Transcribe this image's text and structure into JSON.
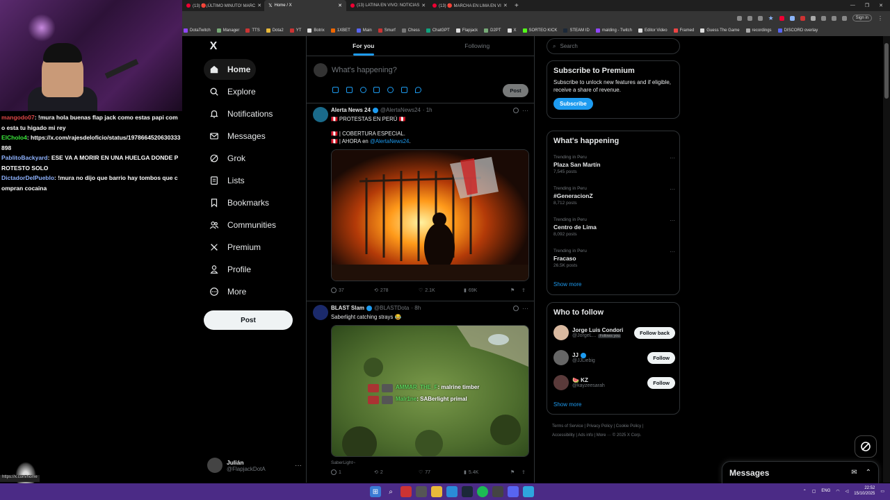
{
  "browser": {
    "tabs": [
      {
        "label": "(13) 🔴¡ÚLTIMO MINUTO! MARC"
      },
      {
        "label": "Home / X"
      },
      {
        "label": "(13) LATINA EN VIVO: NOTICIAS"
      },
      {
        "label": "(13) 🔴 MARCHA EN LIMA EN VI"
      }
    ],
    "new_tab": "+",
    "signin": "Sign in",
    "bookmarks": [
      "DotaTwitch",
      "Manager",
      "TTS",
      "Dota2",
      "YT",
      "Botrix",
      "1XBET",
      "Main",
      "Smurf",
      "Chess",
      "ChatGPT",
      "Flapjack",
      "D2PT",
      "X",
      "SORTEO KICK",
      "STEAM ID",
      "malding - Twitch",
      "Editor Video",
      "Framed",
      "Guess The Game",
      "recordings",
      "DISCORD overlay"
    ]
  },
  "chat": {
    "messages": [
      {
        "user": "mangodo07",
        "color": "#e04848",
        "text": ": !mura hola buenas flap jack como estas papi como esta tu higado mi rey"
      },
      {
        "user": "ElCholo4",
        "color": "#3be83b",
        "text": ": https://x.com/rajesdeloficio/status/1978664520630333898"
      },
      {
        "user": "PablitoBackyard",
        "color": "#8fb3ff",
        "text": ": ESE VA A MORIR EN UNA HUELGA DONDE PROTESTO SOLO"
      },
      {
        "user": "DictadorDelPueblo",
        "color": "#8fb3ff",
        "text": ": !mura no dijo que barrio hay tombos que compran cocaina"
      }
    ],
    "status_url": "https://x.com/home"
  },
  "nav": {
    "logo": "X",
    "items": [
      {
        "label": "Home",
        "icon": "home-icon"
      },
      {
        "label": "Explore",
        "icon": "search-icon"
      },
      {
        "label": "Notifications",
        "icon": "bell-icon"
      },
      {
        "label": "Messages",
        "icon": "envelope-icon"
      },
      {
        "label": "Grok",
        "icon": "grok-icon"
      },
      {
        "label": "Lists",
        "icon": "list-icon"
      },
      {
        "label": "Bookmarks",
        "icon": "bookmark-icon"
      },
      {
        "label": "Communities",
        "icon": "people-icon"
      },
      {
        "label": "Premium",
        "icon": "x-icon"
      },
      {
        "label": "Profile",
        "icon": "person-icon"
      },
      {
        "label": "More",
        "icon": "more-circle-icon"
      }
    ],
    "post_label": "Post",
    "account": {
      "name": "Julián",
      "handle": "@FlapjackDotA"
    }
  },
  "feed": {
    "tabs": [
      "For you",
      "Following"
    ],
    "compose_placeholder": "What's happening?",
    "compose_post": "Post",
    "tweets": [
      {
        "name": "Alerta News 24",
        "handle": "@AlertaNews24",
        "time": "· 1h",
        "line1": "🇵🇪 PROTESTAS EN PERÚ 🇵🇪",
        "line2": "🇵🇪 | COBERTURA ESPECIAL.",
        "line3": "🇵🇪 | AHORA en ",
        "mention": "@AlertaNews24",
        "line3_end": ".",
        "replies": "37",
        "reposts": "278",
        "likes": "2.1K",
        "views": "69K"
      },
      {
        "name": "BLAST Slam",
        "handle": "@BLASTDota",
        "time": "· 8h",
        "line1": "Saberlight catching strays 😂",
        "overlay1_name": "AMMAR_THE_F",
        "overlay1_text": ": malrine timber",
        "overlay2_name": "Malr1ne",
        "overlay2_text": ": SABerlight primal",
        "caption": "SaberLight~",
        "replies": "1",
        "reposts": "2",
        "likes": "77",
        "views": "5.4K"
      }
    ]
  },
  "right": {
    "search_placeholder": "Search",
    "premium": {
      "title": "Subscribe to Premium",
      "text": "Subscribe to unlock new features and if eligible, receive a share of revenue.",
      "button": "Subscribe"
    },
    "happening": {
      "title": "What's happening",
      "trends": [
        {
          "context": "Trending in Peru",
          "topic": "Plaza San Martín",
          "posts": "7,545 posts"
        },
        {
          "context": "Trending in Peru",
          "topic": "#GeneracionZ",
          "posts": "8,712 posts"
        },
        {
          "context": "Trending in Peru",
          "topic": "Centro de Lima",
          "posts": "8,092 posts"
        },
        {
          "context": "Trending in Peru",
          "topic": "Fracaso",
          "posts": "26.5K posts"
        }
      ],
      "show_more": "Show more"
    },
    "who_to_follow": {
      "title": "Who to follow",
      "users": [
        {
          "name": "Jorge Luis Condori",
          "handle": "@JorgeL...",
          "follows_you": "Follows you",
          "button": "Follow back",
          "verified": false,
          "avatar_color": "#d9b9a0"
        },
        {
          "name": "JJ",
          "handle": "@JJLiebig",
          "follows_you": "",
          "button": "Follow",
          "verified": true,
          "avatar_color": "#666"
        },
        {
          "name": "🍉 KZ",
          "handle": "@kayzeesarah",
          "follows_you": "",
          "button": "Follow",
          "verified": false,
          "avatar_color": "#5a3a3a"
        }
      ],
      "show_more": "Show more"
    },
    "footer": {
      "line1": "Terms of Service  |  Privacy Policy  |  Cookie Policy  |",
      "line2": "Accessibility  |  Ads info  |  More ···  © 2025 X Corp."
    }
  },
  "drawer": {
    "title": "Messages"
  },
  "taskbar": {
    "lang": "ENG",
    "time": "22:52",
    "date": "15/10/2025"
  },
  "colors": {
    "accent": "#1d9bf0",
    "taskbar": "#4b2b86"
  }
}
